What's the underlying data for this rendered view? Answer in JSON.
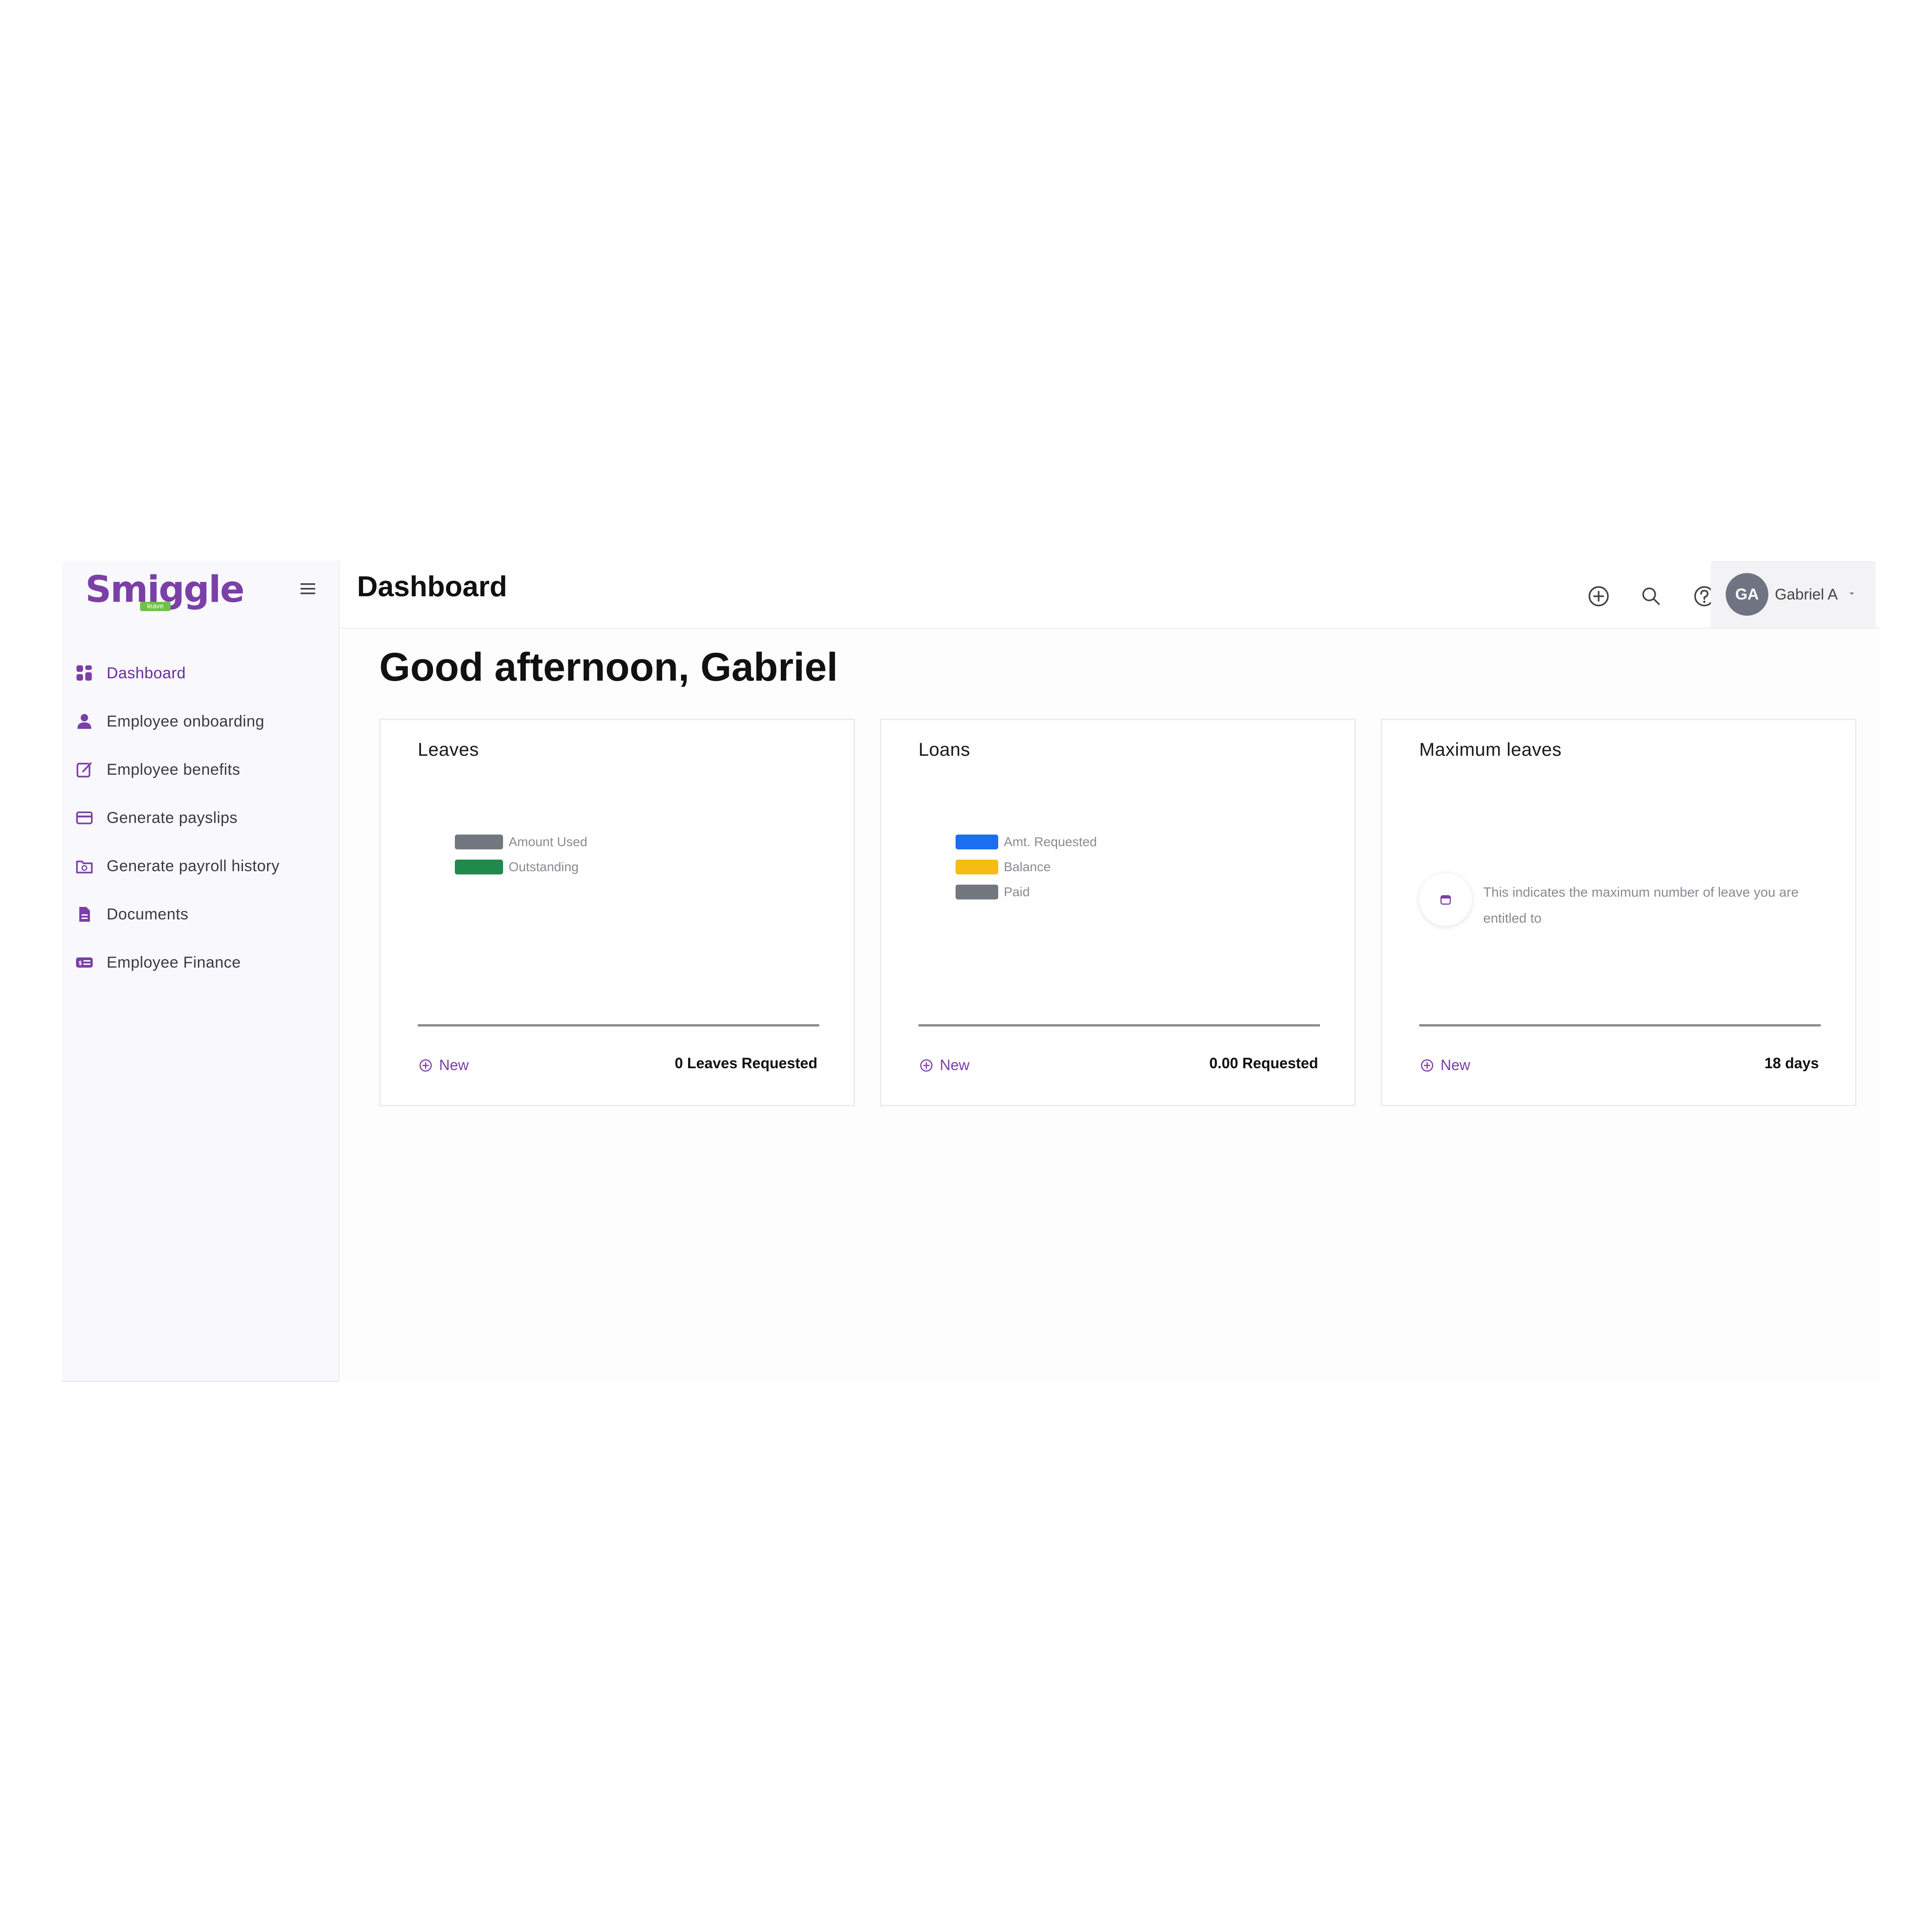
{
  "brand": {
    "name": "Smiggle",
    "tag": "leave"
  },
  "header": {
    "title": "Dashboard",
    "user_initials": "GA",
    "user_name": "Gabriel A"
  },
  "icons": {
    "add": "plus-circle-icon",
    "search": "search-icon",
    "help": "help-circle-icon",
    "menu": "hamburger-menu-icon",
    "caret": "caret-down-icon"
  },
  "sidebar": {
    "items": [
      {
        "label": "Dashboard",
        "icon": "dashboard-grid-icon",
        "active": true
      },
      {
        "label": "Employee onboarding",
        "icon": "user-icon",
        "active": false
      },
      {
        "label": "Employee benefits",
        "icon": "edit-icon",
        "active": false
      },
      {
        "label": "Generate payslips",
        "icon": "card-icon",
        "active": false
      },
      {
        "label": "Generate payroll history",
        "icon": "folder-clock-icon",
        "active": false
      },
      {
        "label": "Documents",
        "icon": "document-icon",
        "active": false
      },
      {
        "label": "Employee Finance",
        "icon": "finance-icon",
        "active": false
      }
    ]
  },
  "greeting": "Good afternoon, Gabriel",
  "cards": {
    "leaves": {
      "title": "Leaves",
      "legend": [
        {
          "label": "Amount Used",
          "color": "#737780"
        },
        {
          "label": "Outstanding",
          "color": "#1f8a4c"
        }
      ],
      "new_label": "New",
      "stat": "0 Leaves Requested"
    },
    "loans": {
      "title": "Loans",
      "legend": [
        {
          "label": "Amt. Requested",
          "color": "#1a6ff0"
        },
        {
          "label": "Balance",
          "color": "#f5bd14"
        },
        {
          "label": "Paid",
          "color": "#737780"
        }
      ],
      "new_label": "New",
      "stat": "0.00 Requested"
    },
    "max_leaves": {
      "title": "Maximum leaves",
      "info_text": "This indicates the maximum number of leave you are entitled to",
      "new_label": "New",
      "stat": "18 days"
    }
  },
  "colors": {
    "brand": "#7b3fa6",
    "brand_tag": "#6cc24a",
    "avatar": "#707482"
  }
}
